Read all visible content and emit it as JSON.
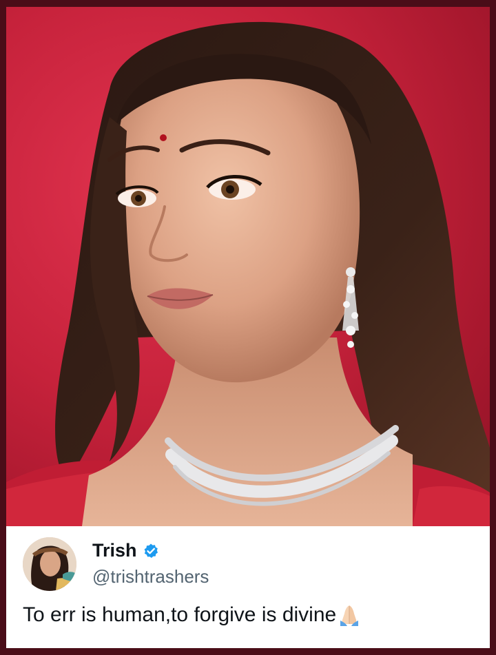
{
  "post": {
    "display_name": "Trish",
    "handle": "@trishtrashers",
    "text": "To err is human,to forgive is divine",
    "emoji": "🙏🏻",
    "verified": true
  },
  "icons": {
    "verified": "verified-badge-icon",
    "emoji": "folded-hands-icon"
  },
  "colors": {
    "frame": "#4a0d18",
    "background_red": "#c6223b",
    "card": "#ffffff",
    "name_text": "#0f1419",
    "handle_text": "#536471",
    "verified_blue": "#1d9bf0"
  }
}
